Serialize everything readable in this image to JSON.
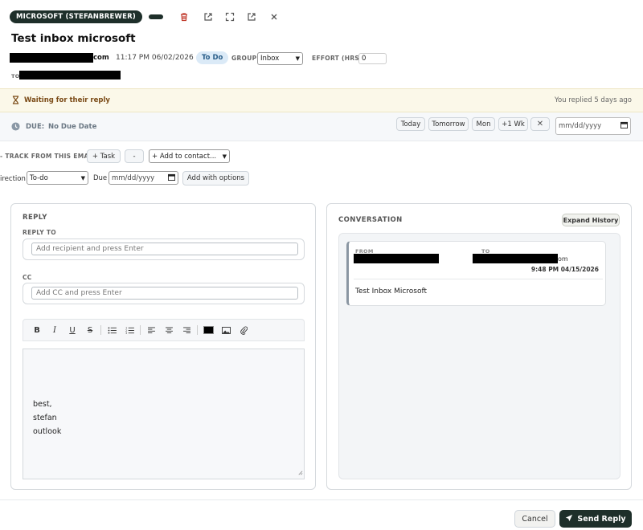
{
  "header": {
    "account_label": "MICROSOFT (STEFANBREWER)",
    "title": "Test inbox microsoft",
    "sender_suffix": "com",
    "timestamp": "11:17 PM 06/02/2026",
    "status_badge": "To Do",
    "group_label": "GROUP",
    "group_value": "Inbox",
    "effort_label": "EFFORT (HRS)",
    "effort_value": "0",
    "to_label": "TO"
  },
  "waiting": {
    "text": "Waiting for their reply",
    "replied": "You replied 5 days ago"
  },
  "due": {
    "label": "DUE:",
    "value": "No Due Date",
    "quick": [
      "Today",
      "Tomorrow",
      "Mon",
      "+1 Wk"
    ],
    "date_placeholder": "mm/dd/yyyy"
  },
  "track": {
    "label": "TRACK FROM THIS EMAIL",
    "task_btn": "+ Task",
    "dash_btn": "-",
    "contact_btn": "+ Add to contact...",
    "direction_label": "irection",
    "direction_value": "To-do",
    "due_label": "Due",
    "due_placeholder": "mm/dd/yyyy",
    "add_options_btn": "Add with options"
  },
  "reply": {
    "title": "REPLY",
    "reply_to_label": "REPLY TO",
    "reply_to_placeholder": "Add recipient and press Enter",
    "cc_label": "CC",
    "cc_placeholder": "Add CC and press Enter",
    "body_lines": [
      "best,",
      "stefan",
      "outlook"
    ]
  },
  "conversation": {
    "title": "CONVERSATION",
    "expand_btn": "Expand History",
    "from_label": "FROM",
    "to_label": "TO",
    "to_suffix": "om",
    "time": "9:48 PM 04/15/2026",
    "snippet": "Test Inbox Microsoft"
  },
  "footer": {
    "cancel": "Cancel",
    "send": "Send Reply"
  },
  "colors": {
    "brand_dark": "#1e2f2a",
    "warning_bg": "#fbf8e9",
    "waiting_text": "#7a4a16",
    "delete_red": "#c0392b"
  }
}
